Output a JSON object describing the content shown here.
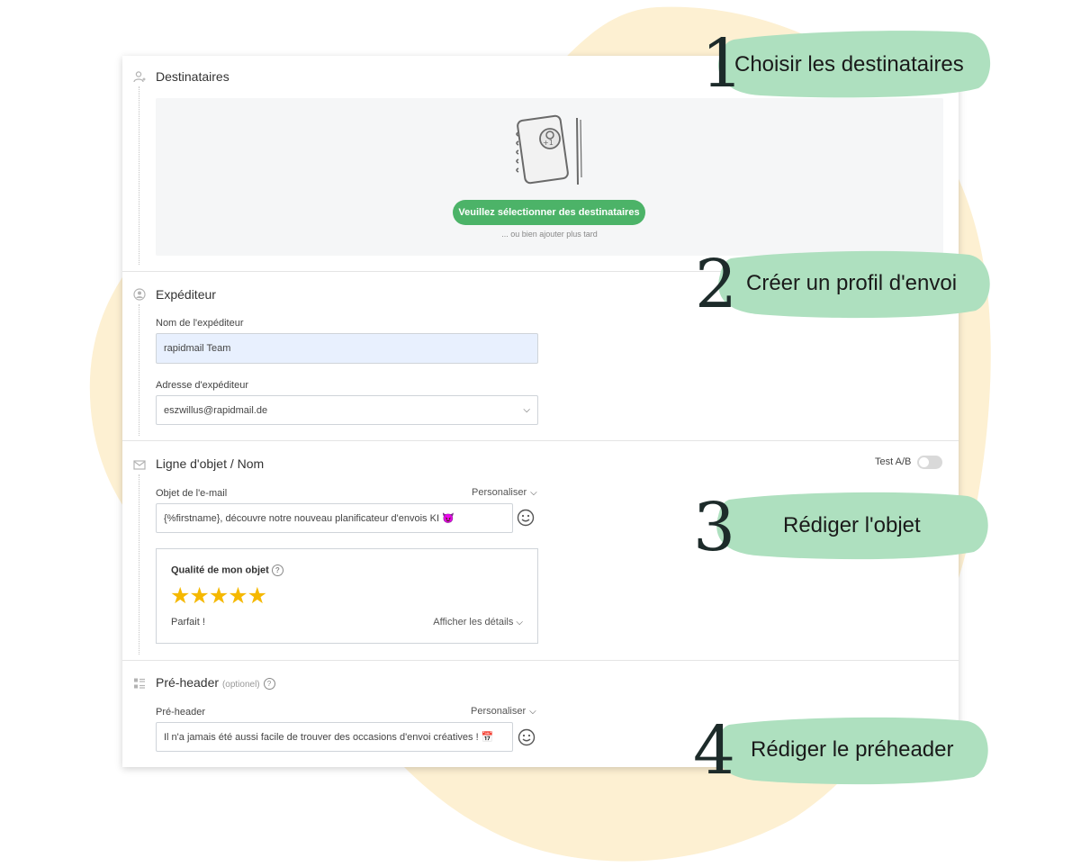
{
  "colors": {
    "accent_green": "#4cb368",
    "callout_green": "#aee0bf",
    "background_blob": "#fdf0d2",
    "star": "#f5b800"
  },
  "sections": {
    "recipients": {
      "title": "Destinataires",
      "button_label": "Veuillez sélectionner des destinataires",
      "later_text": "... ou bien ajouter plus tard",
      "icon": "add-user-icon"
    },
    "sender": {
      "title": "Expéditeur",
      "name_label": "Nom de l'expéditeur",
      "name_value": "rapidmail Team",
      "address_label": "Adresse d'expéditeur",
      "address_value": "eszwillus@rapidmail.de",
      "icon": "user-circle-icon"
    },
    "subject": {
      "title": "Ligne d'objet / Nom",
      "test_ab_label": "Test A/B",
      "test_ab_enabled": false,
      "field_label": "Objet de l'e-mail",
      "personalize_label": "Personaliser",
      "field_value": "{%firstname}, découvre notre nouveau planificateur d'envois KI 😈",
      "quality_title": "Qualité de mon objet",
      "quality_rating": 5,
      "quality_max": 5,
      "stars_text": "★★★★★",
      "quality_status": "Parfait !",
      "details_label": "Afficher les détails",
      "icon": "envelope-icon"
    },
    "preheader": {
      "title": "Pré-header",
      "optional_label": "(optionel)",
      "field_label": "Pré-header",
      "personalize_label": "Personaliser",
      "field_value": "Il n'a jamais été aussi facile de trouver des occasions d'envoi créatives ! 📅",
      "icon": "list-icon"
    }
  },
  "callouts": [
    {
      "number": "1",
      "text": "Choisir les destinataires"
    },
    {
      "number": "2",
      "text": "Créer un profil d'envoi"
    },
    {
      "number": "3",
      "text": "Rédiger l'objet"
    },
    {
      "number": "4",
      "text": "Rédiger le préheader"
    }
  ]
}
